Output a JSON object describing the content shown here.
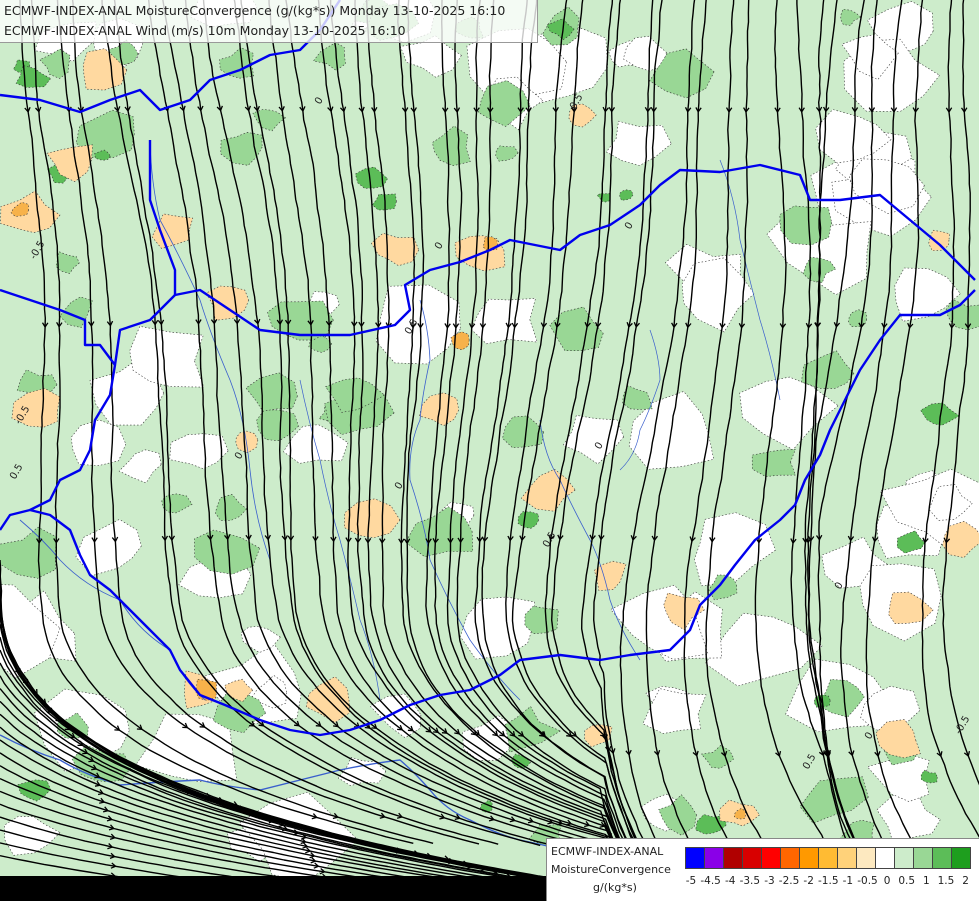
{
  "header": {
    "line1": "ECMWF-INDEX-ANAL MoistureConvergence (g/(kg*s)) Monday 13-10-2025 16:10",
    "line2": "ECMWF-INDEX-ANAL Wind (m/s) 10m Monday 13-10-2025 16:10"
  },
  "legend": {
    "model": "ECMWF-INDEX-ANAL",
    "parameter": "MoistureConvergence",
    "unit": "g/(kg*s)",
    "ticks": [
      "-5",
      "-4.5",
      "-4",
      "-3.5",
      "-3",
      "-2.5",
      "-2",
      "-1.5",
      "-1",
      "-0.5",
      "0",
      "0.5",
      "1",
      "1.5",
      "2"
    ],
    "colors": [
      "#0000ff",
      "#8a00e8",
      "#b00000",
      "#d80000",
      "#ff0000",
      "#ff6600",
      "#ff9900",
      "#ffbb33",
      "#ffd27a",
      "#fde9c0",
      "#ffffff",
      "#cdeccb",
      "#99d795",
      "#5cbd58",
      "#1e9e1e"
    ]
  },
  "map": {
    "contour_labels": [
      "0",
      "0",
      "0.5",
      "-0.5",
      "0",
      "0",
      "0.5",
      "0",
      "-0.5",
      "0",
      "0.5",
      "0",
      "0.5",
      "-0.5",
      "0",
      "0.5"
    ],
    "colors": {
      "border": "#0000ee",
      "river": "#3a5fcd",
      "streamline": "#000000",
      "convergence_light": "#cdeccb",
      "convergence_mid": "#99d795",
      "convergence_strong": "#5cbd58",
      "divergence_light": "#ffd9a0",
      "divergence_mid": "#f7b24a"
    }
  }
}
